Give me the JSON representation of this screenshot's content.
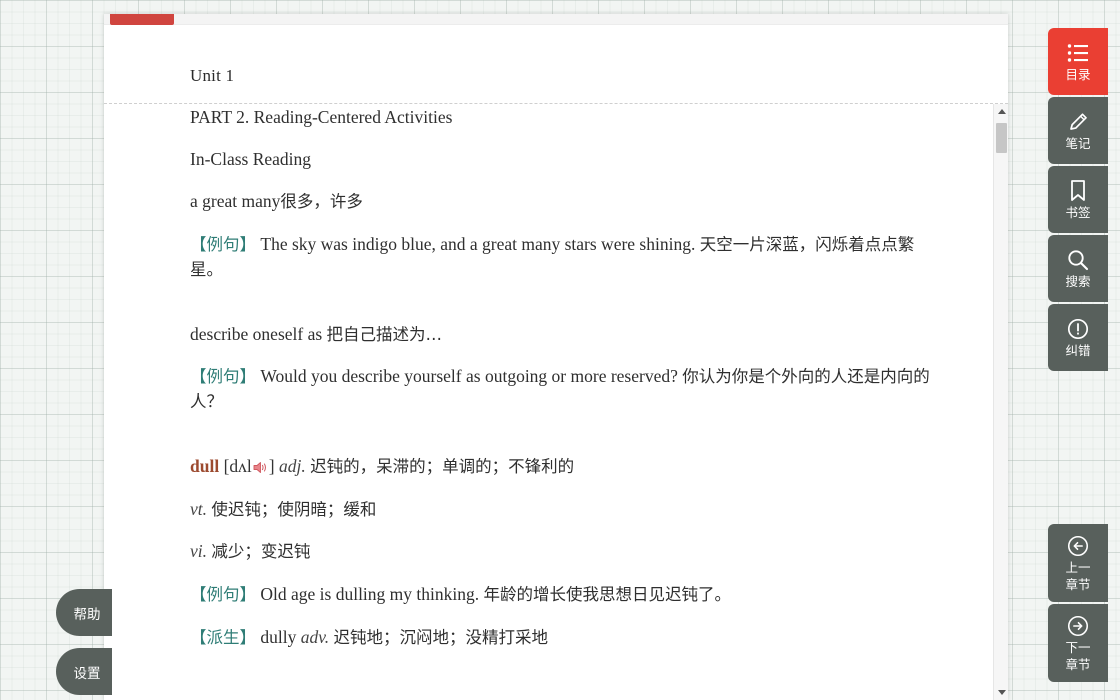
{
  "header": {
    "unit_title": "Unit 1",
    "bookmark_icon": "bookmark-ribbon-icon"
  },
  "content": {
    "part_heading": "PART 2. Reading-Centered Activities",
    "section_heading": "In-Class Reading",
    "entries": [
      {
        "term": "a great many",
        "term_cn": "很多，许多",
        "example_tag": "【例句】",
        "example_en": "The sky was indigo blue, and a great many stars were shining.",
        "example_cn": "天空一片深蓝，闪烁着点点繁星。"
      },
      {
        "term": "describe oneself as ",
        "term_cn": "把自己描述为…",
        "example_tag": "【例句】",
        "example_en": "Would you describe yourself as outgoing or more reserved?",
        "example_cn": "你认为你是个外向的人还是内向的人？"
      }
    ],
    "word_entry": {
      "headword": "dull",
      "phonetic_open": "[",
      "phonetic": "dʌl",
      "speaker_icon": "speaker-icon",
      "phonetic_close": "]",
      "pos_adj": "adj.",
      "def_adj": "迟钝的，呆滞的；单调的；不锋利的",
      "pos_vt": "vt.",
      "def_vt": "使迟钝；使阴暗；缓和",
      "pos_vi": "vi.",
      "def_vi": "减少；变迟钝",
      "example_tag": "【例句】",
      "example_en": "Old age is dulling my thinking.",
      "example_cn": "年龄的增长使我思想日见迟钝了。",
      "derivative_tag": "【派生】",
      "derivative_word": "dully ",
      "derivative_pos": "adv.",
      "derivative_def": "迟钝地；沉闷地；没精打采地"
    }
  },
  "scrollbar": {
    "up_arrow_icon": "chevron-up-icon",
    "down_arrow_icon": "chevron-down-icon"
  },
  "right_toolbar": {
    "items": [
      {
        "label": "目录",
        "icon": "list-icon",
        "active": true
      },
      {
        "label": "笔记",
        "icon": "pencil-icon",
        "active": false
      },
      {
        "label": "书签",
        "icon": "bookmark-icon",
        "active": false
      },
      {
        "label": "搜索",
        "icon": "search-icon",
        "active": false
      },
      {
        "label": "纠错",
        "icon": "exclamation-circle-icon",
        "active": false
      }
    ],
    "nav": [
      {
        "label": "上一\n章节",
        "line1": "上一",
        "line2": "章节",
        "icon": "arrow-left-circle-icon"
      },
      {
        "label": "下一\n章节",
        "line1": "下一",
        "line2": "章节",
        "icon": "arrow-right-circle-icon"
      }
    ]
  },
  "left_buttons": [
    {
      "label": "帮助"
    },
    {
      "label": "设置"
    }
  ],
  "colors": {
    "accent_red": "#ea3f33",
    "tab_red": "#d0453f",
    "toolbar_grey": "#58605c",
    "tag_teal": "#2f7d76",
    "headword_brown": "#9c4a2f",
    "page_white": "#ffffff"
  }
}
